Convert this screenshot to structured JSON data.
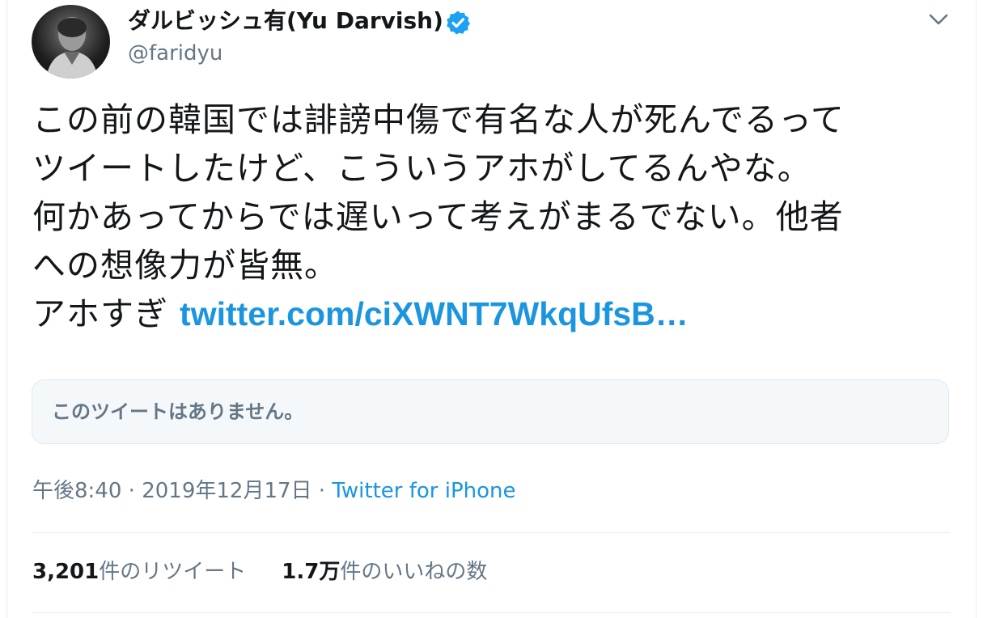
{
  "user": {
    "display_name": "ダルビッシュ有(Yu Darvish)",
    "handle": "@faridyu",
    "verified": true
  },
  "tweet": {
    "lines": [
      "この前の韓国では誹謗中傷で有名な人が死んでるって",
      "ツイートしたけど、こういうアホがしてるんやな。",
      "何かあってからでは遅いって考えがまるでない。他者",
      "への想像力が皆無。"
    ],
    "last_line_prefix": "アホすぎ ",
    "link_text": "twitter.com/ciXWNT7WkqUfsB…"
  },
  "quoted": {
    "unavailable_text": "このツイートはありません。"
  },
  "meta": {
    "time": "午後8:40",
    "date": "2019年12月17日",
    "separator": " · ",
    "source": "Twitter for iPhone"
  },
  "stats": {
    "retweets_count": "3,201",
    "retweets_label": "件のリツイート",
    "likes_count": "1.7万",
    "likes_label": "件のいいねの数"
  },
  "icons": {
    "verified": "verified-badge-icon",
    "menu": "chevron-down-icon"
  },
  "colors": {
    "link": "#1b95e0",
    "secondary_text": "#657786",
    "primary_text": "#14171a",
    "border": "#e6ecf0"
  }
}
